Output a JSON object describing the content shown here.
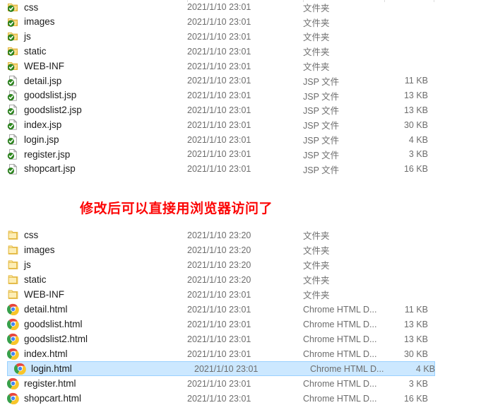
{
  "annotation": {
    "text": "修改后可以直接用浏览器访问了",
    "color": "#fc0505"
  },
  "selection": {
    "fill": "#cce8ff",
    "border": "#99d1ff",
    "selected_row_name": "login.html"
  },
  "panes": [
    {
      "id": "before",
      "rows": [
        {
          "name": "css",
          "icon": "folder-synced-icon",
          "date": "2021/1/10 23:01",
          "type": "文件夹",
          "size": ""
        },
        {
          "name": "images",
          "icon": "folder-synced-icon",
          "date": "2021/1/10 23:01",
          "type": "文件夹",
          "size": ""
        },
        {
          "name": "js",
          "icon": "folder-synced-icon",
          "date": "2021/1/10 23:01",
          "type": "文件夹",
          "size": ""
        },
        {
          "name": "static",
          "icon": "folder-synced-icon",
          "date": "2021/1/10 23:01",
          "type": "文件夹",
          "size": ""
        },
        {
          "name": "WEB-INF",
          "icon": "folder-synced-icon",
          "date": "2021/1/10 23:01",
          "type": "文件夹",
          "size": ""
        },
        {
          "name": "detail.jsp",
          "icon": "document-synced-icon",
          "date": "2021/1/10 23:01",
          "type": "JSP 文件",
          "size": "11 KB"
        },
        {
          "name": "goodslist.jsp",
          "icon": "document-synced-icon",
          "date": "2021/1/10 23:01",
          "type": "JSP 文件",
          "size": "13 KB"
        },
        {
          "name": "goodslist2.jsp",
          "icon": "document-synced-icon",
          "date": "2021/1/10 23:01",
          "type": "JSP 文件",
          "size": "13 KB"
        },
        {
          "name": "index.jsp",
          "icon": "document-synced-icon",
          "date": "2021/1/10 23:01",
          "type": "JSP 文件",
          "size": "30 KB"
        },
        {
          "name": "login.jsp",
          "icon": "document-synced-icon",
          "date": "2021/1/10 23:01",
          "type": "JSP 文件",
          "size": "4 KB"
        },
        {
          "name": "register.jsp",
          "icon": "document-synced-icon",
          "date": "2021/1/10 23:01",
          "type": "JSP 文件",
          "size": "3 KB"
        },
        {
          "name": "shopcart.jsp",
          "icon": "document-synced-icon",
          "date": "2021/1/10 23:01",
          "type": "JSP 文件",
          "size": "16 KB"
        }
      ]
    },
    {
      "id": "after",
      "rows": [
        {
          "name": "css",
          "icon": "folder-icon",
          "date": "2021/1/10 23:20",
          "type": "文件夹",
          "size": "",
          "selected": false
        },
        {
          "name": "images",
          "icon": "folder-icon",
          "date": "2021/1/10 23:20",
          "type": "文件夹",
          "size": "",
          "selected": false
        },
        {
          "name": "js",
          "icon": "folder-icon",
          "date": "2021/1/10 23:20",
          "type": "文件夹",
          "size": "",
          "selected": false
        },
        {
          "name": "static",
          "icon": "folder-icon",
          "date": "2021/1/10 23:20",
          "type": "文件夹",
          "size": "",
          "selected": false
        },
        {
          "name": "WEB-INF",
          "icon": "folder-icon",
          "date": "2021/1/10 23:01",
          "type": "文件夹",
          "size": "",
          "selected": false
        },
        {
          "name": "detail.html",
          "icon": "chrome-icon",
          "date": "2021/1/10 23:01",
          "type": "Chrome HTML D...",
          "size": "11 KB",
          "selected": false
        },
        {
          "name": "goodslist.html",
          "icon": "chrome-icon",
          "date": "2021/1/10 23:01",
          "type": "Chrome HTML D...",
          "size": "13 KB",
          "selected": false
        },
        {
          "name": "goodslist2.html",
          "icon": "chrome-icon",
          "date": "2021/1/10 23:01",
          "type": "Chrome HTML D...",
          "size": "13 KB",
          "selected": false
        },
        {
          "name": "index.html",
          "icon": "chrome-icon",
          "date": "2021/1/10 23:01",
          "type": "Chrome HTML D...",
          "size": "30 KB",
          "selected": false
        },
        {
          "name": "login.html",
          "icon": "chrome-icon",
          "date": "2021/1/10 23:01",
          "type": "Chrome HTML D...",
          "size": "4 KB",
          "selected": true
        },
        {
          "name": "register.html",
          "icon": "chrome-icon",
          "date": "2021/1/10 23:01",
          "type": "Chrome HTML D...",
          "size": "3 KB",
          "selected": false
        },
        {
          "name": "shopcart.html",
          "icon": "chrome-icon",
          "date": "2021/1/10 23:01",
          "type": "Chrome HTML D...",
          "size": "16 KB",
          "selected": false
        }
      ]
    }
  ]
}
